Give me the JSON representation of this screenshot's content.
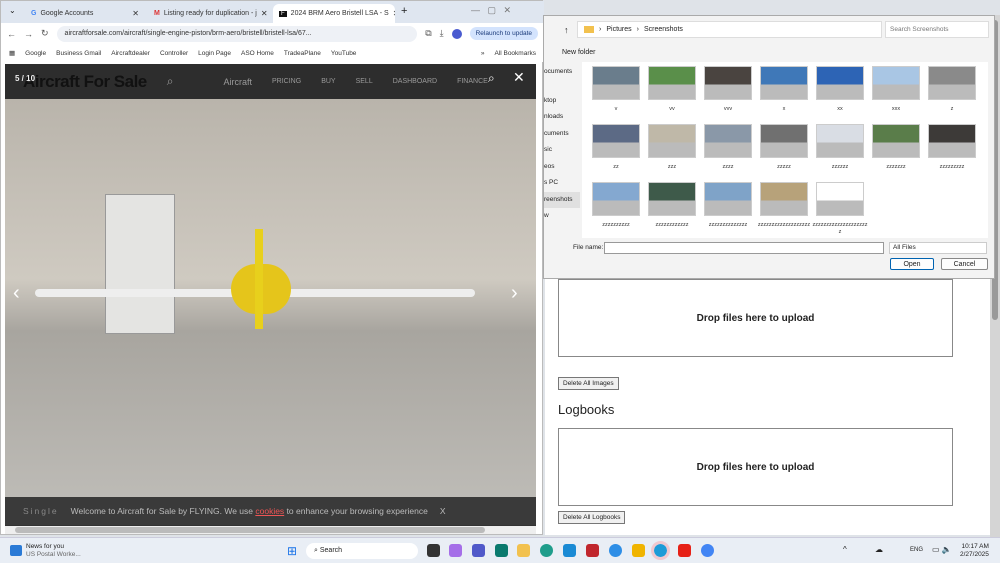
{
  "browser": {
    "tabs": [
      {
        "label": "Google Accounts"
      },
      {
        "label": "Listing ready for duplication - j"
      },
      {
        "label": "2024 BRM Aero Bristell LSA - S"
      }
    ],
    "url": "aircraftforsale.com/aircraft/single-engine-piston/brm-aero/bristell/bristell-lsa/67...",
    "relaunch": "Relaunch to update",
    "bookmarks": [
      "Google",
      "Business Gmail",
      "Aircraftdealer",
      "Controller",
      "Login Page",
      "ASO Home",
      "TradeaPlane",
      "YouTube"
    ],
    "all_bookmarks": "All Bookmarks"
  },
  "site": {
    "logo": "Aircraft For Sale",
    "nav": [
      "Aircraft",
      "PRICING",
      "BUY",
      "SELL",
      "DASHBOARD",
      "FINANCE"
    ],
    "counter": "5 / 10",
    "cookie_prefix": "Single",
    "cookie_text": "Welcome to Aircraft for Sale by FLYING. We use",
    "cookie_link": "cookies",
    "cookie_suffix": "to enhance your browsing experience",
    "cookie_close": "X"
  },
  "dialog": {
    "path": [
      "Pictures",
      "Screenshots"
    ],
    "search_placeholder": "Search Screenshots",
    "new_folder": "New folder",
    "sidebar": [
      "ocuments",
      "ktop",
      "nloads",
      "cuments",
      "sic",
      "eos",
      "s PC",
      "reenshots",
      "w"
    ],
    "files": [
      "v",
      "vv",
      "vvv",
      "x",
      "xx",
      "xxx",
      "z",
      "zz",
      "zzz",
      "zzzz",
      "zzzzz",
      "zzzzzz",
      "zzzzzzz",
      "zzzzzzzzz",
      "zzzzzzzzzz",
      "zzzzzzzzzzzz",
      "zzzzzzzzzzzzzz",
      "zzzzzzzzzzzzzzzzzzz",
      "zzzzzzzzzzzzzzzzzzzzz"
    ],
    "file_name_label": "File name:",
    "file_name_value": "",
    "file_type": "All Files",
    "open": "Open",
    "cancel": "Cancel"
  },
  "upload": {
    "drop_text": "Drop files here to upload",
    "delete_images": "Delete All Images",
    "logbooks_title": "Logbooks",
    "drop_text2": "Drop files here to upload",
    "delete_logbooks": "Delete All Logbooks"
  },
  "taskbar": {
    "news_title": "News for you",
    "news_sub": "US Postal Worke...",
    "search": "Search",
    "lang": "ENG",
    "time": "10:17 AM",
    "date": "2/27/2025"
  }
}
